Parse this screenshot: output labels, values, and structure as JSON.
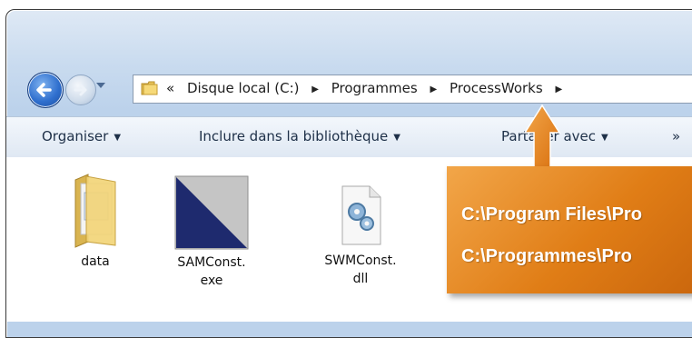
{
  "addressbar": {
    "overflow": "«",
    "crumbs": [
      "Disque local (C:)",
      "Programmes",
      "ProcessWorks"
    ]
  },
  "toolbar": {
    "organiser": "Organiser",
    "include": "Inclure dans la bibliothèque",
    "share": "Partager avec",
    "more": "»"
  },
  "files": [
    {
      "name": "data",
      "type": "folder-icon"
    },
    {
      "name_line1": "SAMConst.",
      "name_line2": "exe",
      "type": "exe-icon"
    },
    {
      "name_line1": "SWMConst.",
      "name_line2": "dll",
      "type": "dll-icon"
    }
  ],
  "callout": {
    "line1": "C:\\Program Files\\Pro",
    "line2": "C:\\Programmes\\Pro",
    "color": "#e07d16"
  }
}
